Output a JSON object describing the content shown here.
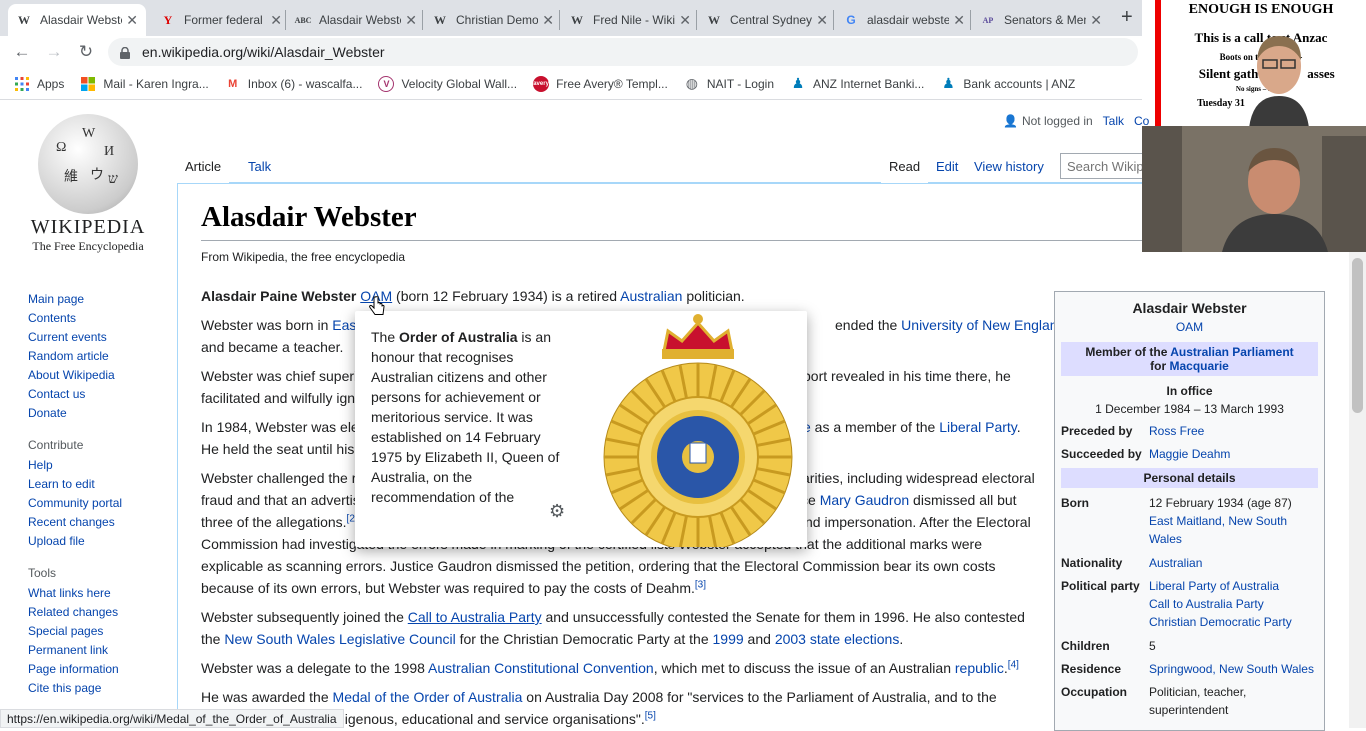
{
  "browser": {
    "tabs": [
      {
        "favicon": "W",
        "title": "Alasdair Webster",
        "active": true
      },
      {
        "favicon": "Y",
        "title": "Former federal",
        "active": false
      },
      {
        "favicon": "ABC",
        "title": "Alasdair Webster",
        "active": false
      },
      {
        "favicon": "W",
        "title": "Christian Democratic",
        "active": false
      },
      {
        "favicon": "W",
        "title": "Fred Nile - Wikipedia",
        "active": false
      },
      {
        "favicon": "W",
        "title": "Central Sydney",
        "active": false
      },
      {
        "favicon": "G",
        "title": "alasdair webster",
        "active": false
      },
      {
        "favicon": "AP",
        "title": "Senators & Members",
        "active": false
      }
    ],
    "url": "en.wikipedia.org/wiki/Alasdair_Webster",
    "bookmarks": [
      {
        "icon": "apps-icon",
        "label": "Apps"
      },
      {
        "icon": "windows-icon",
        "label": "Mail - Karen Ingra..."
      },
      {
        "icon": "gmail-icon",
        "label": "Inbox (6) - wascalfa..."
      },
      {
        "icon": "velocity-icon",
        "label": "Velocity Global Wall..."
      },
      {
        "icon": "avery-icon",
        "label": "Free Avery® Templ..."
      },
      {
        "icon": "globe-icon",
        "label": "NAIT - Login"
      },
      {
        "icon": "anz-icon",
        "label": "ANZ Internet Banki..."
      },
      {
        "icon": "anz-icon",
        "label": "Bank accounts | ANZ"
      }
    ],
    "status_url": "https://en.wikipedia.org/wiki/Medal_of_the_Order_of_Australia"
  },
  "wiki": {
    "logo_word": "WIKIPEDIA",
    "logo_sub": "The Free Encyclopedia",
    "nav": [
      "Main page",
      "Contents",
      "Current events",
      "Random article",
      "About Wikipedia",
      "Contact us",
      "Donate"
    ],
    "contribute_heading": "Contribute",
    "contribute": [
      "Help",
      "Learn to edit",
      "Community portal",
      "Recent changes",
      "Upload file"
    ],
    "tools_heading": "Tools",
    "tools": [
      "What links here",
      "Related changes",
      "Special pages",
      "Permanent link",
      "Page information",
      "Cite this page"
    ],
    "personal": {
      "status": "Not logged in",
      "talk": "Talk",
      "contrib": "Co"
    },
    "tabs": {
      "article": "Article",
      "talk": "Talk",
      "read": "Read",
      "edit": "Edit",
      "history": "View history"
    },
    "search_placeholder": "Search Wikip",
    "title": "Alasdair Webster",
    "from": "From Wikipedia, the free encyclopedia"
  },
  "article": {
    "p1": {
      "bold": "Alasdair Paine Webster",
      "oam": "OAM",
      "t1": " (born 12 February 1934) is a retired ",
      "link": "Australian",
      "t2": " politician."
    },
    "p2": {
      "a": "Webster was born in ",
      "l1": "East",
      "b": "ended the ",
      "l2": "University of New England",
      "c": ",",
      "d": "and became a teacher."
    },
    "p3": {
      "a": "Webster was chief superi",
      "b": "port revealed in his time there, he",
      "c": "facilitated and wilfully igno"
    },
    "p4": {
      "a": "In 1984, Webster was ele",
      "l1": "e",
      "b": " as a member of the ",
      "l2": "Liberal Party",
      "c": ".",
      "d": "He held the seat until his"
    },
    "p5": {
      "a": "Webster challenged the r",
      "b": "arities, including widespread electoral",
      "c": "fraud and that an advertis",
      "d": "ce ",
      "l1": "Mary Gaudron",
      "e": " dismissed all but",
      "f": "three of the allegations.",
      "s1": "[2",
      "g": "nd impersonation. After the Electoral",
      "h": "Commission had investigated the errors made in marking of the certified lists Webster accepted that the additional marks were",
      "i": "explicable as scanning errors. Justice Gaudron dismissed the petition, ordering that the Electoral Commission bear its own costs",
      "j": "because of its own errors, but Webster was required to pay the costs of Deahm.",
      "s2": "[3]"
    },
    "p6": {
      "a": "Webster subsequently joined the ",
      "l1": "Call to Australia Party",
      "b": " and unsuccessfully contested the Senate for them in 1996. He also contested",
      "c": "the ",
      "l2": "New South Wales Legislative Council",
      "d": " for the ",
      "l3": "Christian Democratic Party",
      "e": " at the ",
      "l4": "1999",
      "f": " and ",
      "l5": "2003 state elections",
      "g": "."
    },
    "p7": {
      "a": "Webster was a delegate to the 1998 ",
      "l1": "Australian Constitutional Convention",
      "b": ", which met to discuss the issue of an Australian ",
      "l2": "republic",
      "c": ".",
      "s": "[4]"
    },
    "p8": {
      "a": "He was awarded the ",
      "l1": "Medal of the Order of Australia",
      "b": " on Australia Day 2008 for \"services to the Parliament of Australia, and to the",
      "c": "digenous, educational and service organisations\".",
      "s": "[5]"
    }
  },
  "popup": {
    "t1": "The ",
    "bold": "Order of Australia",
    "t2": " is an honour that recognises Australian citizens and other persons for achievement or meritorious service. It was established on 14 February 1975 by Elizabeth II, Queen of Australia, on the recommendation of the"
  },
  "infobox": {
    "name": "Alasdair Webster",
    "post": "OAM",
    "member_a": "Member of the ",
    "member_l": "Australian Parliament",
    "member_b": "for ",
    "member_l2": "Macquarie",
    "office_h": "In office",
    "office_dates": "1 December 1984 – 13 March 1993",
    "preceded_k": "Preceded by",
    "preceded_v": "Ross Free",
    "succeeded_k": "Succeeded by",
    "succeeded_v": "Maggie Deahm",
    "personal_h": "Personal details",
    "born_k": "Born",
    "born_v": "12 February 1934 (age 87)",
    "born_l": "East Maitland, New South Wales",
    "nat_k": "Nationality",
    "nat_v": "Australian",
    "party_k": "Political party",
    "party_v1": "Liberal Party of Australia",
    "party_v2": "Call to Australia Party",
    "party_v3": "Christian Democratic Party",
    "children_k": "Children",
    "children_v": "5",
    "res_k": "Residence",
    "res_v": "Springwood, New South Wales",
    "occ_k": "Occupation",
    "occ_v": "Politician, teacher, superintendent"
  },
  "webcam": {
    "l1": "ENOUGH IS ENOUGH",
    "l2": "This is a call to st  Anzac",
    "l3": "Boots on the ground -",
    "l4": "Silent gathering",
    "l5": "asses",
    "l6": "No signs – No Sp",
    "l7": "Tuesday 31"
  }
}
